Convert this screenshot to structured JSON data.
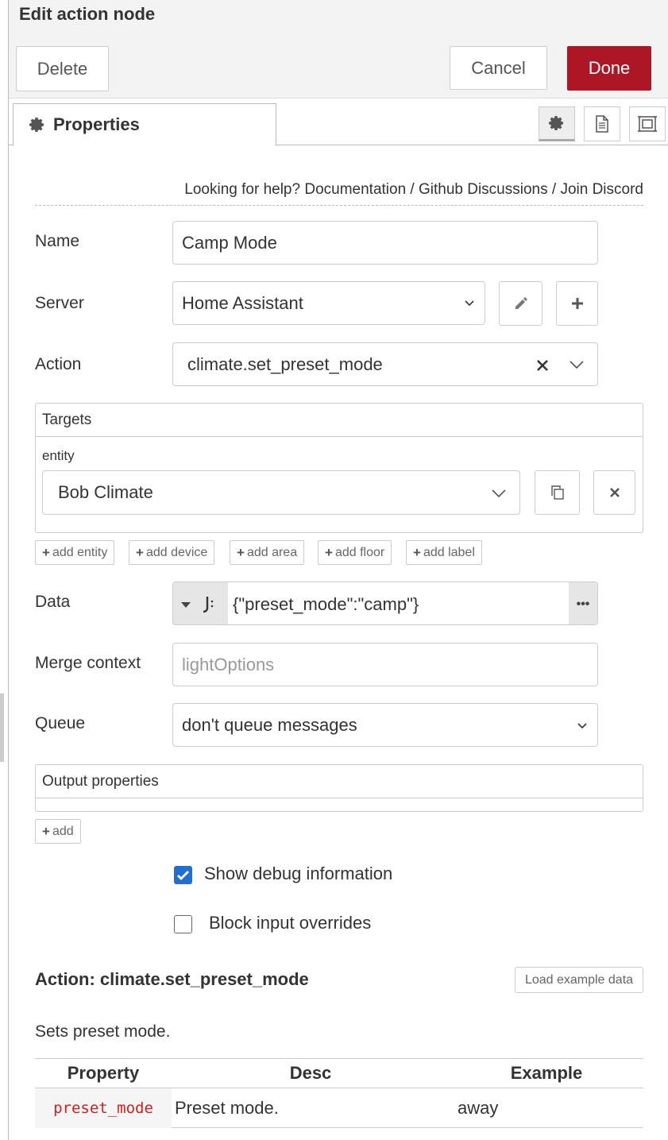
{
  "header": {
    "title": "Edit action node",
    "delete_label": "Delete",
    "cancel_label": "Cancel",
    "done_label": "Done",
    "done_color": "#ad1625"
  },
  "tabs": {
    "properties_label": "Properties",
    "icons": [
      "gear-icon",
      "description-icon",
      "appearance-icon"
    ]
  },
  "help": {
    "prefix": "Looking for help?",
    "links": [
      "Documentation",
      "Github Discussions",
      "Join Discord"
    ],
    "separator": "/"
  },
  "form": {
    "name_label": "Name",
    "name_value": "Camp Mode",
    "server_label": "Server",
    "server_value": "Home Assistant",
    "action_label": "Action",
    "action_value": "climate.set_preset_mode",
    "targets_title": "Targets",
    "entity_label": "entity",
    "entity_value": "Bob Climate",
    "add_buttons": [
      "add entity",
      "add device",
      "add area",
      "add floor",
      "add label"
    ],
    "data_label": "Data",
    "data_value": "{\"preset_mode\":\"camp\"}",
    "merge_label": "Merge context",
    "merge_placeholder": "lightOptions",
    "queue_label": "Queue",
    "queue_value": "don't queue messages",
    "output_title": "Output properties",
    "output_add": "add",
    "debug_label": "Show debug information",
    "debug_checked": true,
    "block_label": "Block input overrides",
    "block_checked": false
  },
  "docs": {
    "title": "Action: climate.set_preset_mode",
    "load_example": "Load example data",
    "description": "Sets preset mode.",
    "columns": [
      "Property",
      "Desc",
      "Example"
    ],
    "rows": [
      {
        "property": "preset_mode",
        "desc": "Preset mode.",
        "example": "away"
      }
    ]
  },
  "colors": {
    "accent": "#1f6fd0",
    "code": "#cc2222"
  }
}
